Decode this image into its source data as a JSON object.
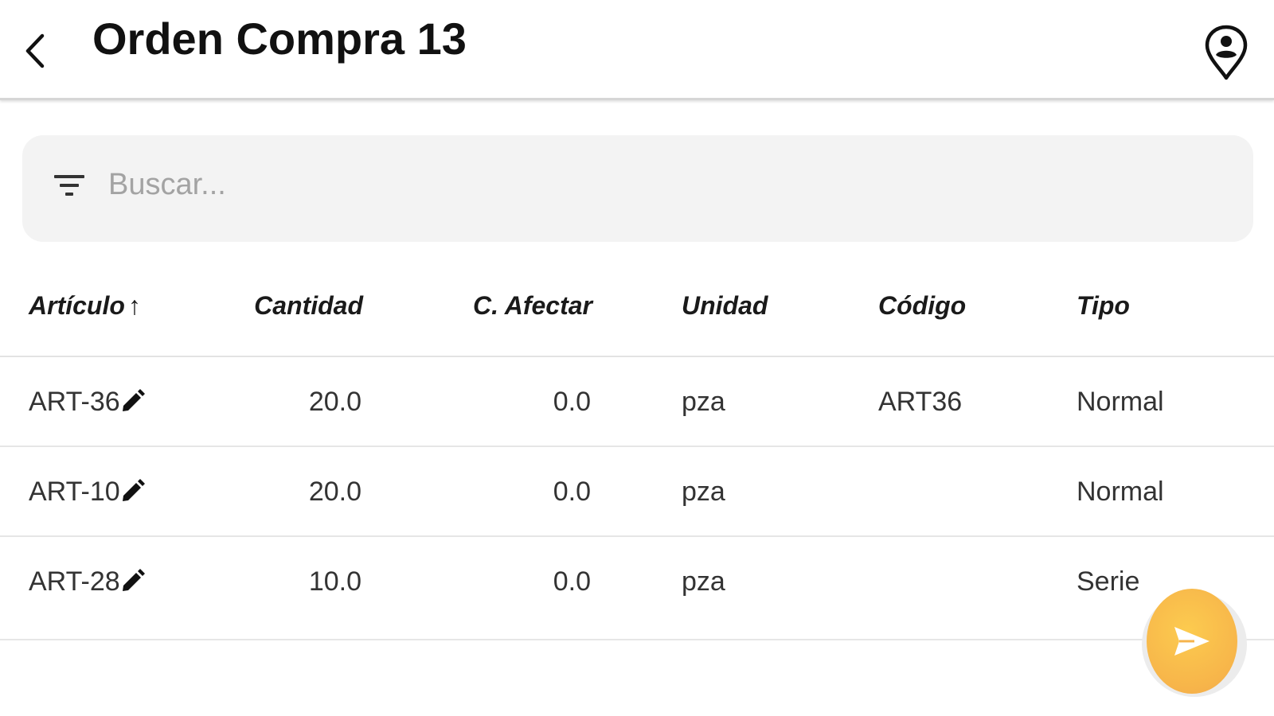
{
  "header": {
    "title": "Orden Compra 13",
    "back_icon": "chevron-left-icon",
    "location_icon": "location-person-icon"
  },
  "search": {
    "placeholder": "Buscar...",
    "value": "",
    "icon": "filter-icon"
  },
  "table": {
    "sort_indicator": "↑",
    "columns": [
      "Artículo",
      "Cantidad",
      "C. Afectar",
      "Unidad",
      "Código",
      "Tipo"
    ],
    "rows": [
      {
        "articulo": "ART-36",
        "cantidad": "20.0",
        "afectar": "0.0",
        "unidad": "pza",
        "codigo": "ART36",
        "tipo": "Normal"
      },
      {
        "articulo": "ART-10",
        "cantidad": "20.0",
        "afectar": "0.0",
        "unidad": "pza",
        "codigo": "",
        "tipo": "Normal"
      },
      {
        "articulo": "ART-28",
        "cantidad": "10.0",
        "afectar": "0.0",
        "unidad": "pza",
        "codigo": "",
        "tipo": "Serie"
      }
    ]
  },
  "fab": {
    "icon": "send-icon",
    "color": "#f8b84a"
  }
}
